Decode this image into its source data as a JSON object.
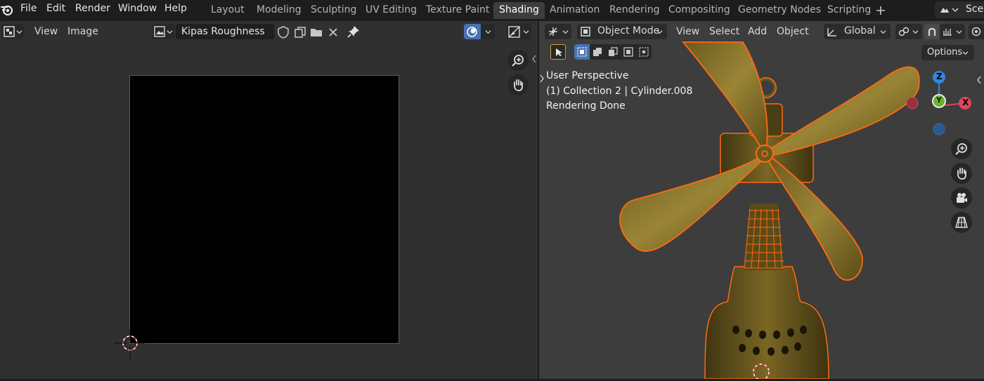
{
  "menubar": {
    "items": [
      "File",
      "Edit",
      "Render",
      "Window",
      "Help"
    ],
    "logo_icon": "blender-logo-icon"
  },
  "workspaces": {
    "tabs": [
      "Layout",
      "Modeling",
      "Sculpting",
      "UV Editing",
      "Texture Paint",
      "Shading",
      "Animation",
      "Rendering",
      "Compositing",
      "Geometry Nodes",
      "Scripting"
    ],
    "active": "Shading",
    "add_icon": "plus-icon",
    "scene_label": "Scer"
  },
  "image_editor": {
    "header": {
      "view_label": "View",
      "image_label": "Image",
      "image_name": "Kipas Roughness"
    },
    "icons": [
      "editor-type-icon",
      "image-browse-icon",
      "fake-user-shield-icon",
      "duplicate-image-icon",
      "open-folder-icon",
      "unlink-close-icon",
      "pin-icon",
      "overlay-icon",
      "display-channels-icon",
      "zoom-icon",
      "hand-pan-icon",
      "cursor-crosshair-icon"
    ]
  },
  "viewport": {
    "header": {
      "mode_label": "Object Mode",
      "view_label": "View",
      "select_label": "Select",
      "add_label": "Add",
      "object_label": "Object",
      "transform_label": "Global",
      "options_label": "Options"
    },
    "overlay_text": {
      "perspective": "User Perspective",
      "collection": "(1) Collection 2 | Cylinder.008",
      "status": "Rendering Done"
    },
    "gizmo": {
      "z_label": "Z",
      "y_label": "Y",
      "x_label": "X"
    },
    "colors": {
      "selection_outline": "#ff6a10",
      "fan_material": "#8a7020",
      "x_axis": "#e0445c",
      "y_axis": "#6ab42a",
      "z_axis": "#2f86dd"
    }
  }
}
